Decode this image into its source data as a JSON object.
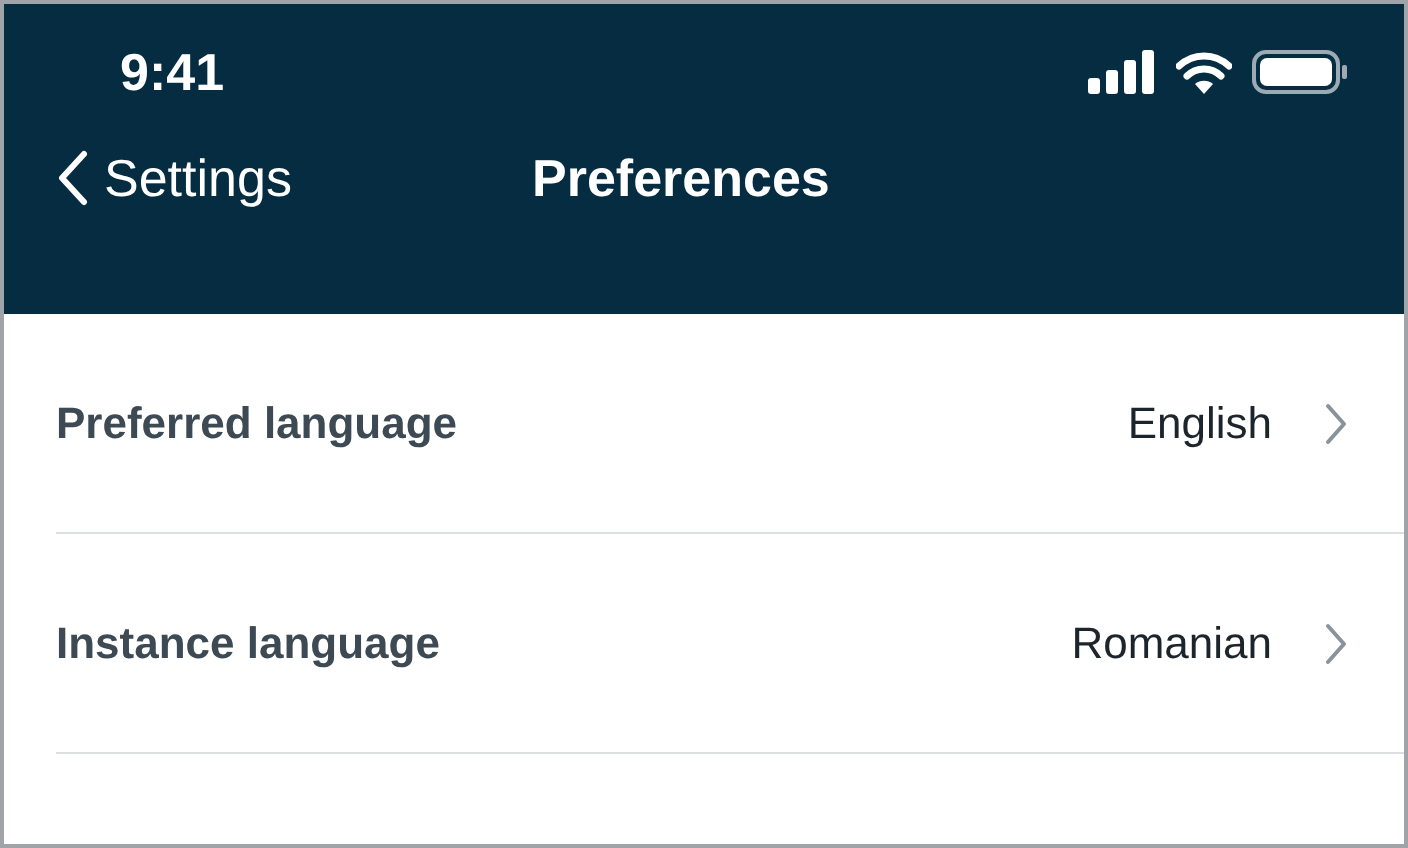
{
  "status_bar": {
    "time": "9:41"
  },
  "nav": {
    "back_label": "Settings",
    "title": "Preferences"
  },
  "rows": [
    {
      "label": "Preferred language",
      "value": "English"
    },
    {
      "label": "Instance language",
      "value": "Romanian"
    }
  ]
}
